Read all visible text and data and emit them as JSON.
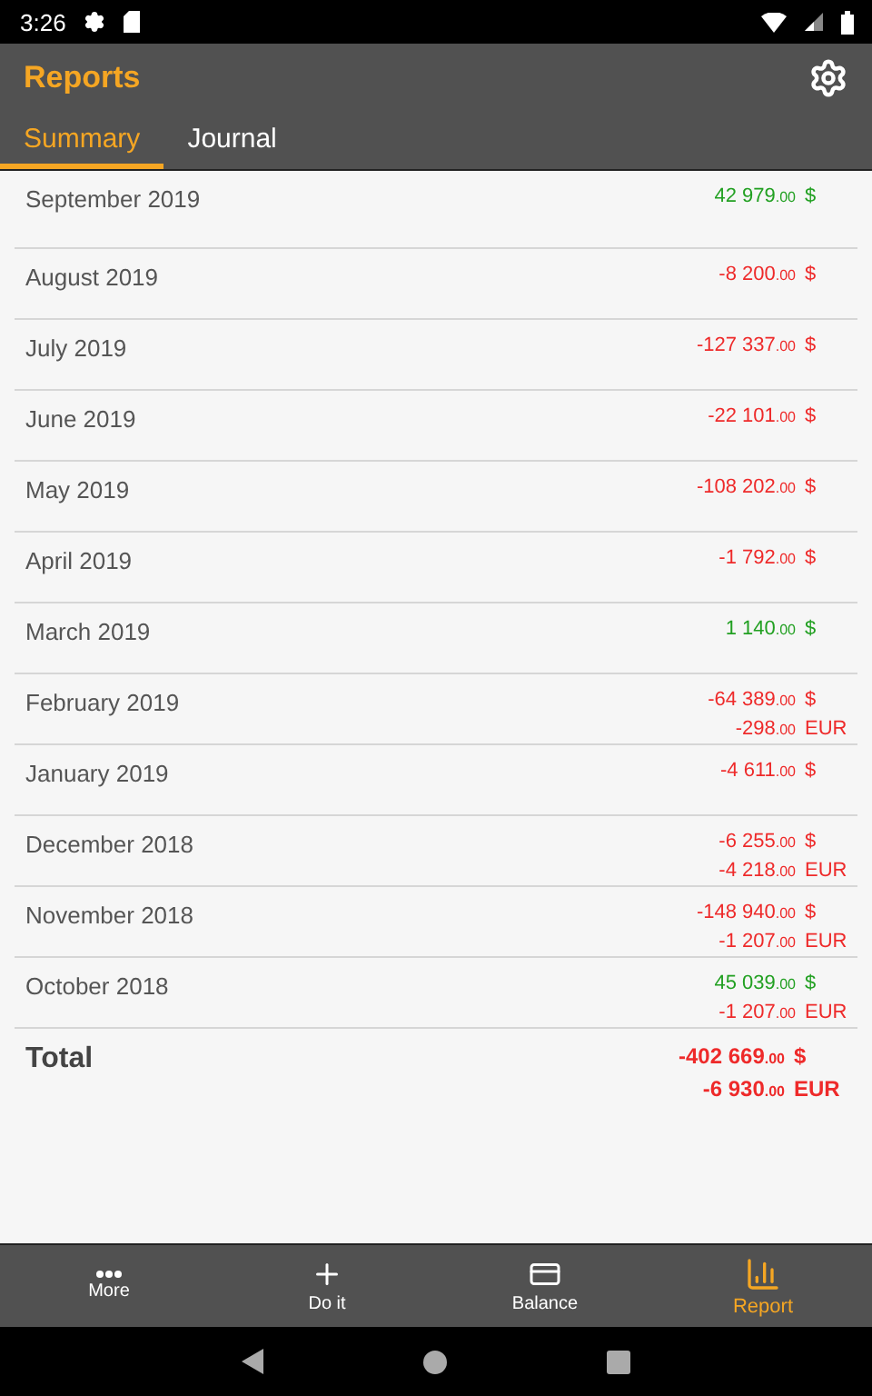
{
  "status_bar": {
    "time": "3:26"
  },
  "app_bar": {
    "title": "Reports"
  },
  "tabs": [
    {
      "label": "Summary",
      "selected": true
    },
    {
      "label": "Journal",
      "selected": false
    }
  ],
  "rows": [
    {
      "label": "September 2019",
      "amounts": [
        {
          "whole": "42 979",
          "cents": ".00",
          "currency": "$",
          "color": "#22a022"
        }
      ]
    },
    {
      "label": "August 2019",
      "amounts": [
        {
          "whole": "-8 200",
          "cents": ".00",
          "currency": "$",
          "color": "#ee2a2a"
        }
      ]
    },
    {
      "label": "July 2019",
      "amounts": [
        {
          "whole": "-127 337",
          "cents": ".00",
          "currency": "$",
          "color": "#ee2a2a"
        }
      ]
    },
    {
      "label": "June 2019",
      "amounts": [
        {
          "whole": "-22 101",
          "cents": ".00",
          "currency": "$",
          "color": "#ee2a2a"
        }
      ]
    },
    {
      "label": "May 2019",
      "amounts": [
        {
          "whole": "-108 202",
          "cents": ".00",
          "currency": "$",
          "color": "#ee2a2a"
        }
      ]
    },
    {
      "label": "April 2019",
      "amounts": [
        {
          "whole": "-1 792",
          "cents": ".00",
          "currency": "$",
          "color": "#ee2a2a"
        }
      ]
    },
    {
      "label": "March 2019",
      "amounts": [
        {
          "whole": "1 140",
          "cents": ".00",
          "currency": "$",
          "color": "#22a022"
        }
      ]
    },
    {
      "label": "February 2019",
      "amounts": [
        {
          "whole": "-64 389",
          "cents": ".00",
          "currency": "$",
          "color": "#ee2a2a"
        },
        {
          "whole": "-298",
          "cents": ".00",
          "currency": "EUR",
          "color": "#ee2a2a"
        }
      ]
    },
    {
      "label": "January 2019",
      "amounts": [
        {
          "whole": "-4 611",
          "cents": ".00",
          "currency": "$",
          "color": "#ee2a2a"
        }
      ]
    },
    {
      "label": "December 2018",
      "amounts": [
        {
          "whole": "-6 255",
          "cents": ".00",
          "currency": "$",
          "color": "#ee2a2a"
        },
        {
          "whole": "-4 218",
          "cents": ".00",
          "currency": "EUR",
          "color": "#ee2a2a"
        }
      ]
    },
    {
      "label": "November 2018",
      "amounts": [
        {
          "whole": "-148 940",
          "cents": ".00",
          "currency": "$",
          "color": "#ee2a2a"
        },
        {
          "whole": "-1 207",
          "cents": ".00",
          "currency": "EUR",
          "color": "#ee2a2a"
        }
      ]
    },
    {
      "label": "October 2018",
      "amounts": [
        {
          "whole": "45 039",
          "cents": ".00",
          "currency": "$",
          "color": "#22a022"
        },
        {
          "whole": "-1 207",
          "cents": ".00",
          "currency": "EUR",
          "color": "#ee2a2a"
        }
      ]
    }
  ],
  "total": {
    "label": "Total",
    "amounts": [
      {
        "whole": "-402 669",
        "cents": ".00",
        "currency": "$",
        "color": "#ee2a2a"
      },
      {
        "whole": "-6 930",
        "cents": ".00",
        "currency": "EUR",
        "color": "#ee2a2a"
      }
    ]
  },
  "bottom_nav": [
    {
      "kind": "more",
      "label": "More",
      "selected": false
    },
    {
      "kind": "add",
      "label": "Do it",
      "selected": false
    },
    {
      "kind": "balance",
      "label": "Balance",
      "selected": false
    },
    {
      "kind": "report",
      "label": "Report",
      "selected": true
    }
  ]
}
